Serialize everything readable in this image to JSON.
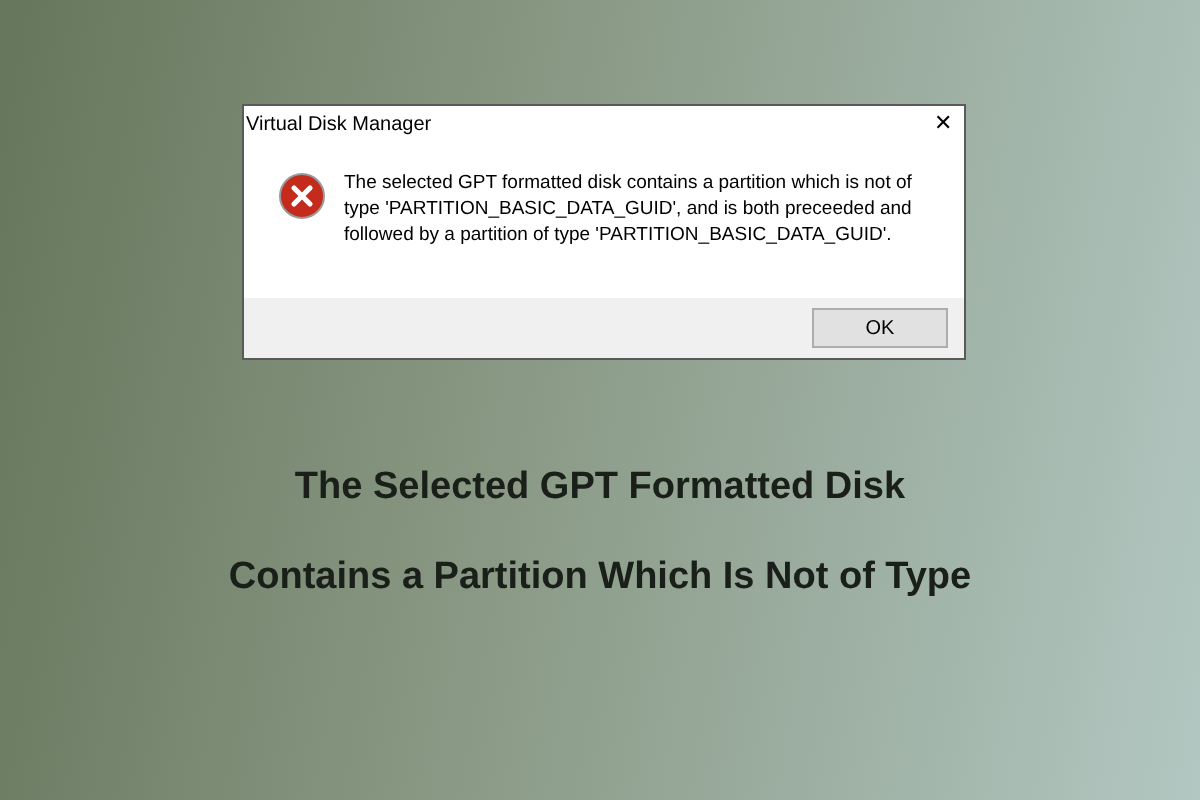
{
  "dialog": {
    "title": "Virtual Disk Manager",
    "close": "✕",
    "kind": "error",
    "message": "The selected GPT formatted disk contains a partition which is not of type  'PARTITION_BASIC_DATA_GUID', and is both preceeded and followed by a partition  of type 'PARTITION_BASIC_DATA_GUID'.",
    "buttons": [
      "OK"
    ]
  },
  "headline": [
    "The Selected GPT Formatted Disk",
    "Contains a Partition Which Is Not of Type"
  ]
}
